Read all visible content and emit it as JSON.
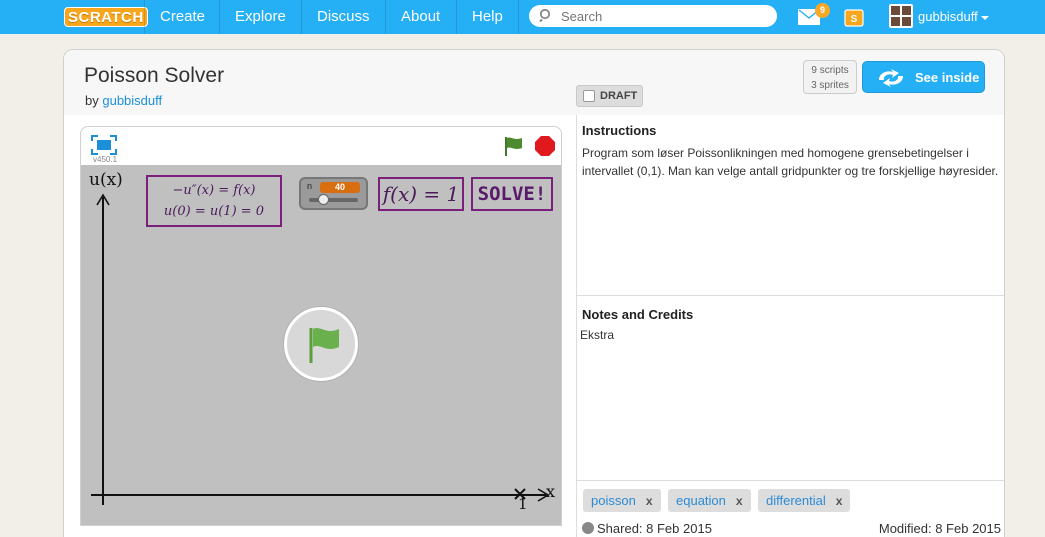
{
  "nav": {
    "logo": "SCRATCH",
    "items": [
      "Create",
      "Explore",
      "Discuss",
      "About",
      "Help"
    ],
    "search_placeholder": "Search",
    "message_count": "9",
    "username": "gubbisduff"
  },
  "project": {
    "title": "Poisson Solver",
    "by_prefix": "by",
    "author": "gubbisduff",
    "scripts_count": "9 scripts",
    "sprites_count": "3 sprites",
    "see_inside": "See inside",
    "draft": "DRAFT"
  },
  "player": {
    "version": "v450.1",
    "equation_line1": "−u″(x) = f(x)",
    "equation_line2": "u(0) = u(1) = 0",
    "slider_name": "n",
    "slider_value": "40",
    "fx_text": "f(x) = 1",
    "solve_text": "SOLVE!",
    "y_axis_label": "u(x)",
    "x_axis_label": "x",
    "x_tick_label": "1"
  },
  "info": {
    "instructions_title": "Instructions",
    "instructions_text": "Program som løser Poissonlikningen med homogene grensebetingelser i intervallet (0,1). Man kan velge antall gridpunkter og tre forskjellige høyresider.",
    "notes_title": "Notes and Credits",
    "notes_text": "Ekstra",
    "tags": [
      "poisson",
      "equation",
      "differential"
    ],
    "tag_remove": "x",
    "shared": "Shared: 8 Feb 2015",
    "modified": "Modified: 8 Feb 2015"
  },
  "colors": {
    "nav_blue": "#25aff4",
    "link_blue": "#1b8fd8",
    "stage_gray": "#c0c0c0",
    "purple_border": "#7a1f7a",
    "flag_green": "#6ab04c",
    "stop_red": "#e0191f"
  }
}
